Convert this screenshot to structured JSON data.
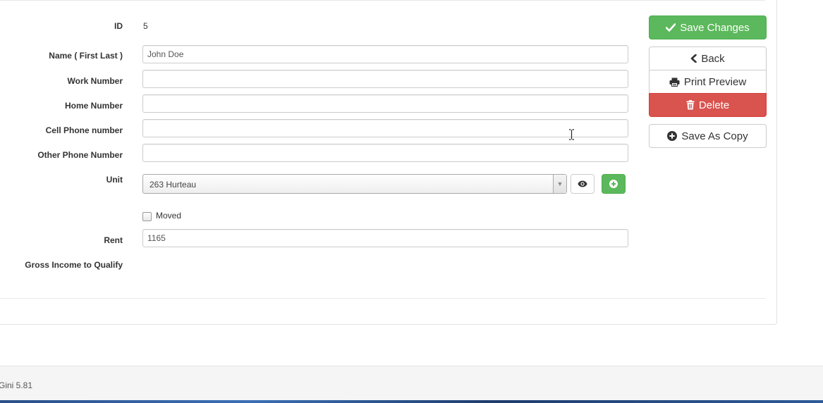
{
  "form": {
    "id": {
      "label": "ID",
      "value": "5"
    },
    "name": {
      "label": "Name ( First Last )",
      "value": "John Doe"
    },
    "work_number": {
      "label": "Work Number",
      "value": ""
    },
    "home_number": {
      "label": "Home Number",
      "value": ""
    },
    "cell_number": {
      "label": "Cell Phone number",
      "value": ""
    },
    "other_number": {
      "label": "Other Phone Number",
      "value": ""
    },
    "unit": {
      "label": "Unit",
      "selected": "263 Hurteau"
    },
    "moved": {
      "label": "Moved",
      "checked": false
    },
    "rent": {
      "label": "Rent",
      "value": "1165"
    },
    "gross_income": {
      "label": "Gross Income to Qualify",
      "value": ""
    }
  },
  "actions": {
    "save": "Save Changes",
    "back": "Back",
    "print": "Print Preview",
    "delete": "Delete",
    "save_copy": "Save As Copy"
  },
  "colors": {
    "success": "#5cb85c",
    "danger": "#d9534f",
    "border": "#cccccc"
  },
  "footer": {
    "version": "Gini 5.81"
  }
}
